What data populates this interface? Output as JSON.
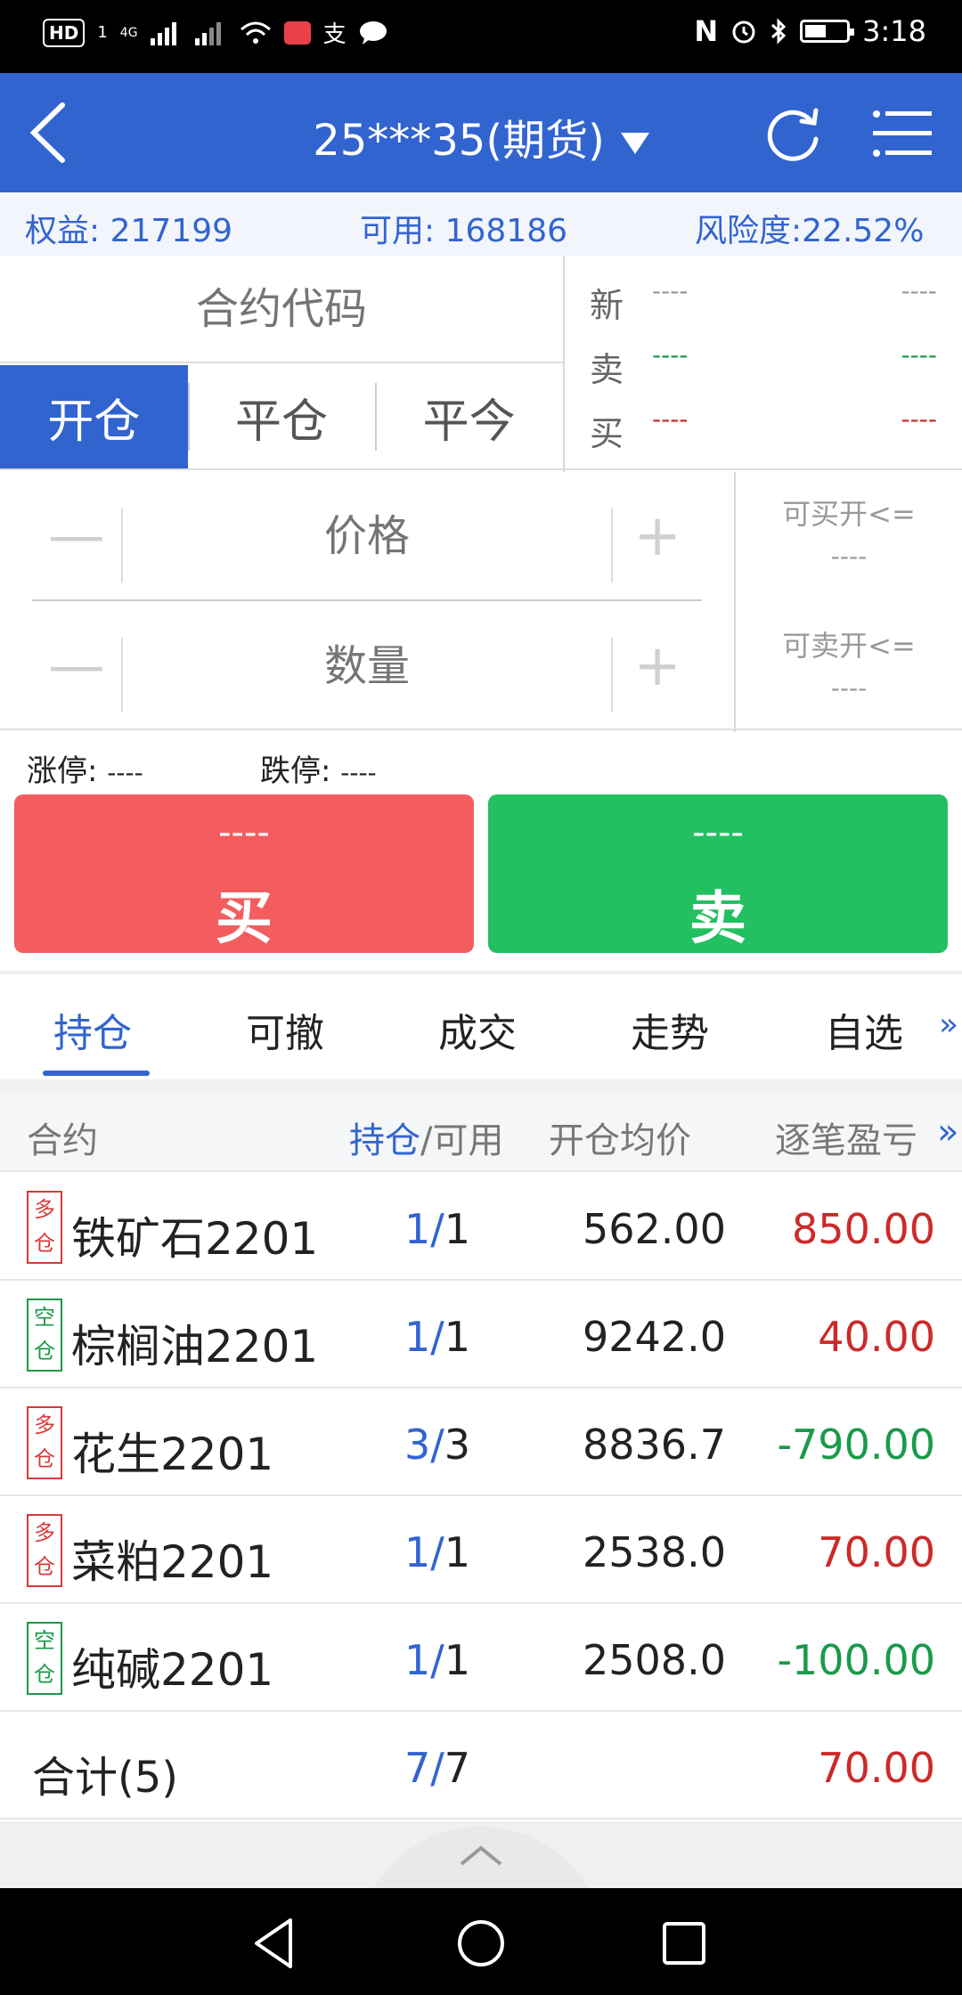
{
  "status_bar": {
    "hd": "HD",
    "hd_sub": "1",
    "network": "4G",
    "pay": "支",
    "time": "3:18",
    "nfc": "N"
  },
  "header": {
    "title": "25***35(期货)"
  },
  "account": {
    "equity_label": "权益:",
    "equity_value": "217199",
    "available_label": "可用:",
    "available_value": "168186",
    "risk_label": "风险度:",
    "risk_value": "22.52%"
  },
  "order": {
    "contract_placeholder": "合约代码",
    "tabs": [
      {
        "label": "开仓",
        "active": true
      },
      {
        "label": "平仓",
        "active": false
      },
      {
        "label": "平今",
        "active": false
      }
    ],
    "quote": {
      "last_label": "新",
      "ask_label": "卖",
      "bid_label": "买",
      "last_v1": "----",
      "last_v2": "----",
      "ask_v1": "----",
      "ask_v2": "----",
      "bid_v1": "----",
      "bid_v2": "----"
    },
    "price_placeholder": "价格",
    "qty_placeholder": "数量",
    "minus": "—",
    "plus": "+",
    "buy_open_label": "可买开<=",
    "buy_open_value": "----",
    "sell_open_label": "可卖开<=",
    "sell_open_value": "----",
    "limit_up_label": "涨停:",
    "limit_up_value": "----",
    "limit_down_label": "跌停:",
    "limit_down_value": "----",
    "buy_price": "----",
    "buy_label": "买",
    "sell_price": "----",
    "sell_label": "卖"
  },
  "subtabs": {
    "items": [
      "持仓",
      "可撤",
      "成交",
      "走势",
      "自选"
    ],
    "active_index": 0,
    "more": "»"
  },
  "table": {
    "headers": {
      "contract": "合约",
      "held": "持仓",
      "available": "/可用",
      "avg_price": "开仓均价",
      "pnl": "逐笔盈亏",
      "more": "»"
    },
    "rows": [
      {
        "dir_top": "多",
        "dir_bottom": "仓",
        "dir": "long",
        "name": "铁矿石2201",
        "held": "1",
        "avail": "1",
        "avg": "562.00",
        "pnl": "850.00",
        "sign": "pos"
      },
      {
        "dir_top": "空",
        "dir_bottom": "仓",
        "dir": "short",
        "name": "棕榈油2201",
        "held": "1",
        "avail": "1",
        "avg": "9242.0",
        "pnl": "40.00",
        "sign": "pos"
      },
      {
        "dir_top": "多",
        "dir_bottom": "仓",
        "dir": "long",
        "name": "花生2201",
        "held": "3",
        "avail": "3",
        "avg": "8836.7",
        "pnl": "-790.00",
        "sign": "neg"
      },
      {
        "dir_top": "多",
        "dir_bottom": "仓",
        "dir": "long",
        "name": "菜粕2201",
        "held": "1",
        "avail": "1",
        "avg": "2538.0",
        "pnl": "70.00",
        "sign": "pos"
      },
      {
        "dir_top": "空",
        "dir_bottom": "仓",
        "dir": "short",
        "name": "纯碱2201",
        "held": "1",
        "avail": "1",
        "avg": "2508.0",
        "pnl": "-100.00",
        "sign": "neg"
      }
    ],
    "total": {
      "label": "合计(5)",
      "held": "7",
      "avail": "7",
      "pnl": "70.00"
    }
  },
  "colors": {
    "brand": "#3264d0",
    "buy": "#f45d5f",
    "sell": "#22c060",
    "profit": "#cc2a2a",
    "loss": "#1a9a4a"
  }
}
